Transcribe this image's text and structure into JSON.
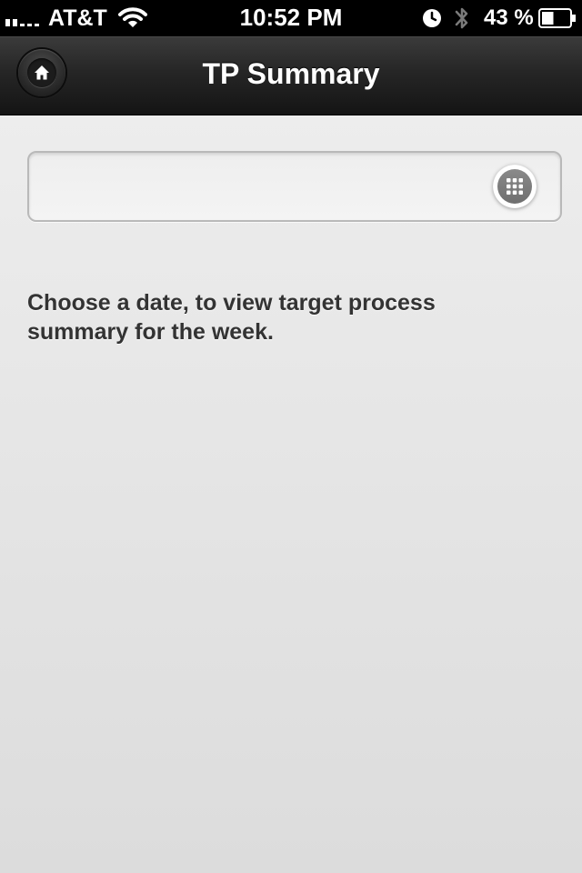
{
  "status_bar": {
    "carrier": "AT&T",
    "time": "10:52 PM",
    "battery_percent": "43 %",
    "battery_level": 0.43,
    "signal_bars_filled": 2,
    "signal_bars_total": 5,
    "icons": [
      "signal-icon",
      "wifi-icon",
      "alarm-icon",
      "bluetooth-icon",
      "battery-icon"
    ]
  },
  "header": {
    "title": "TP Summary",
    "home_icon": "home-icon"
  },
  "date_picker": {
    "value": "",
    "placeholder": "",
    "calendar_icon": "calendar-grid-icon"
  },
  "instructions": "Choose a date, to view target process summary for the week.",
  "colors": {
    "header_bg": "#262626",
    "page_bg": "#ededed",
    "text": "#333333"
  }
}
